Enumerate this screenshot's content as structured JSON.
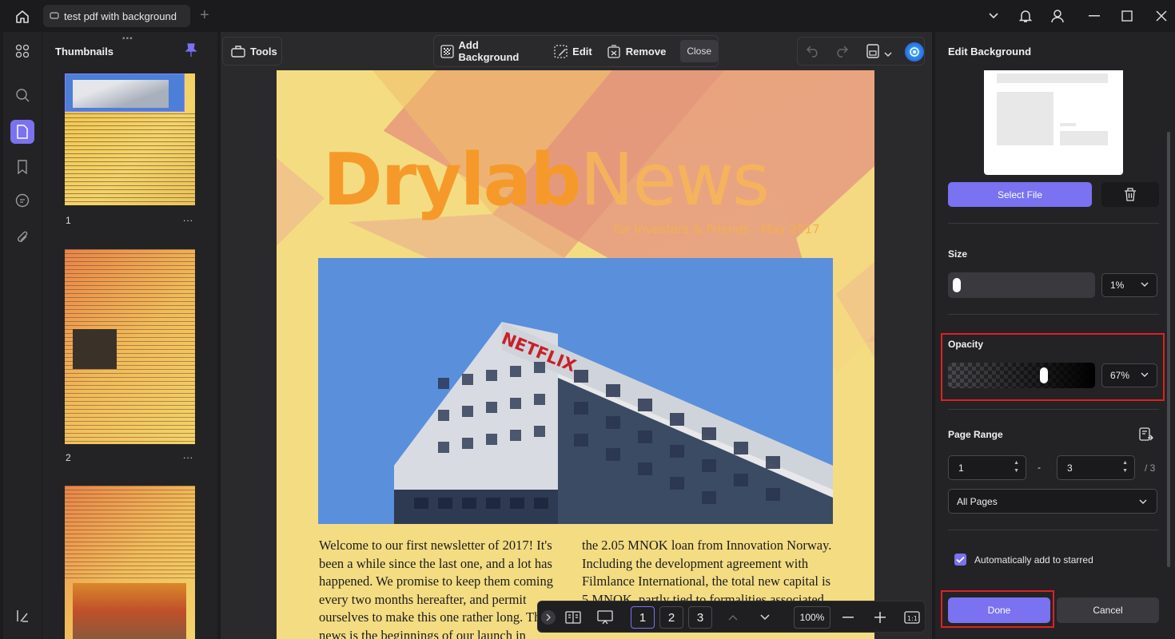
{
  "window": {
    "tab_title": "test pdf with background"
  },
  "thumbnails": {
    "header": "Thumbnails",
    "pages": [
      {
        "number": "1",
        "menu": "..."
      },
      {
        "number": "2",
        "menu": "..."
      }
    ]
  },
  "toolbar": {
    "tools_label": "Tools",
    "add_background_label": "Add Background",
    "edit_label": "Edit",
    "remove_label": "Remove",
    "close_label": "Close"
  },
  "document": {
    "title_bold": "Drylab",
    "title_light": "News",
    "subtitle": "for Investors & Friends · May 2017",
    "sign_text": "NETFLIX",
    "col1": "Welcome to our first newsletter of 2017! It's been a while since the last one, and a lot has happened. We promise to keep them coming every two months hereafter, and permit ourselves to make this one rather long. The big news is the beginnings of our launch in",
    "col2": "the 2.05 MNOK loan from Innovation Norway. Including the development agreement with Filmlance International, the total new capital is 5 MNOK, partly tied to formalities associated with this process are"
  },
  "bottom_bar": {
    "pages": [
      "1",
      "2",
      "3"
    ],
    "zoom": "100%"
  },
  "panel": {
    "title": "Edit Background",
    "select_file_label": "Select File",
    "size_label": "Size",
    "size_value": "1%",
    "size_level": 0.01,
    "opacity_label": "Opacity",
    "opacity_value": "67%",
    "opacity_level": 0.67,
    "page_range_label": "Page Range",
    "range_from": "1",
    "range_dash": "-",
    "range_to": "3",
    "range_total": "/ 3",
    "pages_select": "All Pages",
    "auto_star_label": "Automatically add to starred",
    "auto_star_checked": true,
    "done_label": "Done",
    "cancel_label": "Cancel"
  },
  "colors": {
    "accent": "#7a72f0",
    "highlight": "#e02020",
    "title_orange": "#f59a2a"
  }
}
